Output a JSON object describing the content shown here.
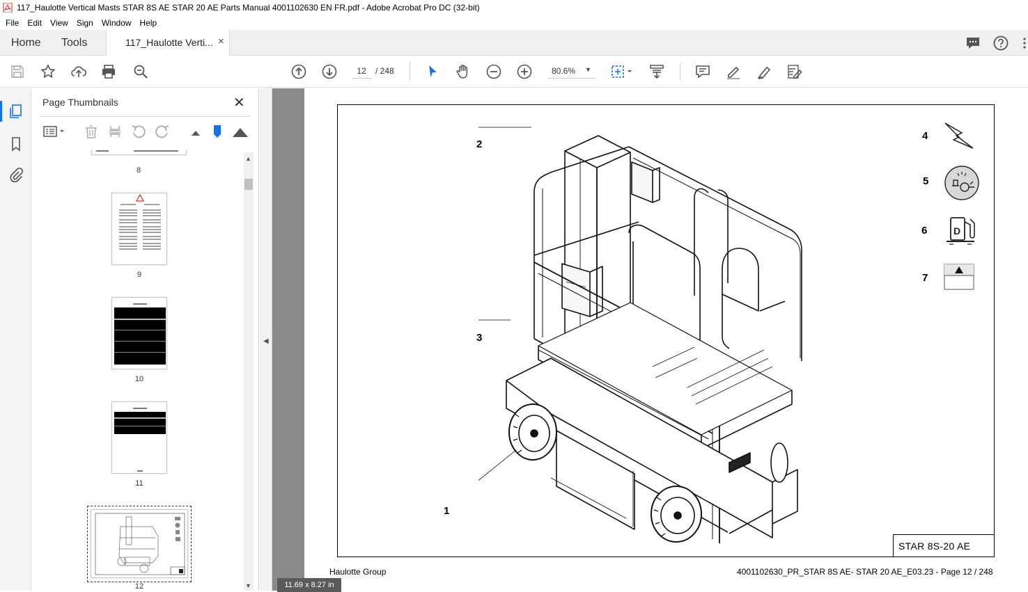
{
  "window": {
    "title": "117_Haulotte Vertical Masts STAR 8S AE STAR 20 AE Parts Manual 4001102630 EN FR.pdf - Adobe Acrobat Pro DC (32-bit)"
  },
  "menu": [
    "File",
    "Edit",
    "View",
    "Sign",
    "Window",
    "Help"
  ],
  "tabs": {
    "home": "Home",
    "tools": "Tools",
    "document": "117_Haulotte Verti...",
    "close": "×"
  },
  "toolbar": {
    "current_page": "12",
    "total_pages": "/ 248",
    "zoom": "80.6%"
  },
  "thumbnails": {
    "title": "Page Thumbnails",
    "close": "✕",
    "pages": [
      "8",
      "9",
      "10",
      "11",
      "12"
    ]
  },
  "document": {
    "callouts": [
      "1",
      "2",
      "3",
      "4",
      "5",
      "6",
      "7"
    ],
    "model_label": "STAR 8S-20 AE",
    "footer_left": "Haulotte Group",
    "footer_right": "4001102630_PR_STAR 8S AE- STAR 20 AE_E03.23 - Page 12 / 248",
    "page_size": "11.69 x 8.27 in"
  },
  "colors": {
    "accent": "#1473e6",
    "acrobat_red": "#e02020"
  }
}
